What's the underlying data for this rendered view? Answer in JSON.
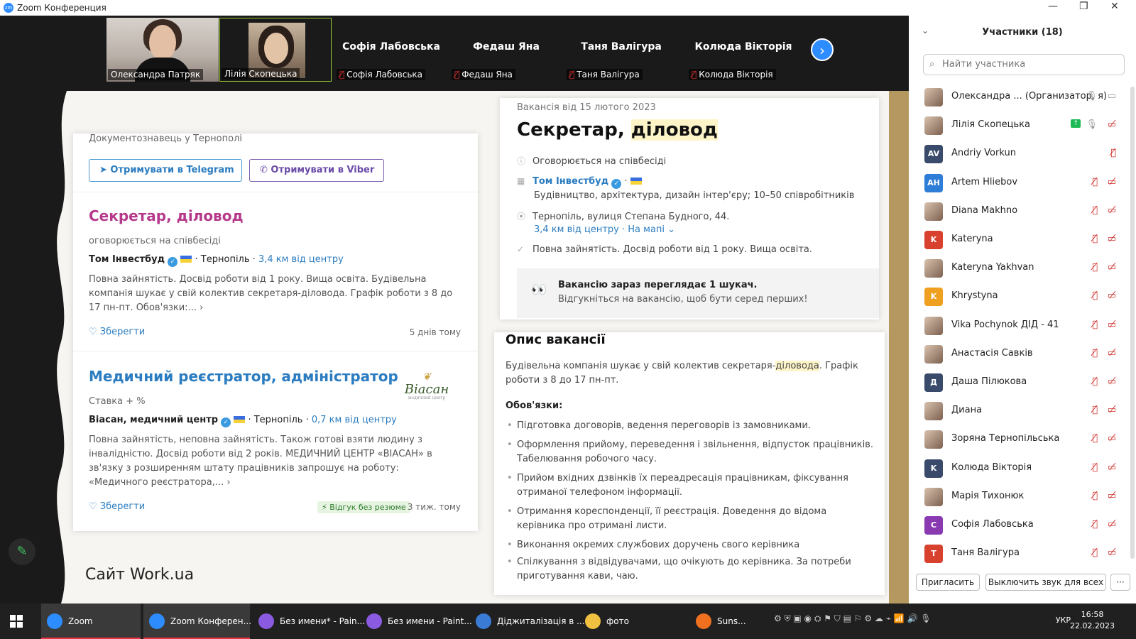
{
  "window": {
    "title": "Zoom Конференция"
  },
  "strip": {
    "tiles": [
      {
        "name": "Олександра Патряк"
      },
      {
        "name": "Лілія Скопецька"
      },
      {
        "name": "Софія Лабовська",
        "label": "Софія Лабовська"
      },
      {
        "name": "Федаш Яна",
        "label": "Федаш Яна"
      },
      {
        "name": "Таня Валігура",
        "label": "Таня Валігура"
      },
      {
        "name": "Колюда Вікторія",
        "label": "Колюда Вікторія"
      }
    ]
  },
  "left": {
    "header": "Документознавець у Тернополі",
    "telegram": "Отримувати в Telegram",
    "viber": "Отримувати в Viber",
    "jobs": [
      {
        "title": "Секретар, діловод",
        "salary": "оговорюється на співбесіді",
        "company": "Том Інвестбуд",
        "city": "· Тернопіль ·",
        "distance": "3,4 км від центру",
        "desc": "Повна зайнятість. Досвід роботи від 1 року. Вища освіта. Будівельна компанія шукає у свій колектив секретаря-діловода. Графік роботи з 8 до 17 пн-пт. Обов'язки:... ›",
        "save": "Зберегти",
        "ago": "5 днів тому"
      },
      {
        "title": "Медичний реєстратор, адміністратор",
        "salary": "Ставка + %",
        "company": "Віасан, медичний центр",
        "city": "· Тернопіль ·",
        "distance": "0,7 км від центру",
        "desc": "Повна зайнятість, неповна зайнятість. Також готові взяти людину з інвалідністю. Досвід роботи від 2 років. МЕДИЧНИЙ ЦЕНТР «ВІАСАН» в зв'язку з розширенням штату працівників запрошує на роботу: «Медичного реєстратора,... ›",
        "save": "Зберегти",
        "badge": "⚡ Відгук без резюме",
        "ago": "3 тиж. тому",
        "logo": "Віасан",
        "logo_sub": "медичний центр"
      }
    ],
    "site_label": "Сайт Work.ua"
  },
  "right": {
    "posted": "Вакансія від 15 лютого 2023",
    "title_a": "Секретар, ",
    "title_b": "діловод",
    "salary": "Оговорюється на співбесіді",
    "company": "Том Інвестбуд",
    "company_info": "Будівництво, архітектура, дизайн інтер'єру; 10–50 співробітників",
    "address": "Тернопіль, вулиця Степана Будного, 44.",
    "distance": "3,4 км від центру",
    "map": "· На мапі ⌄",
    "terms": "Повна зайнятість. Досвід роботи від 1 року. Вища освіта.",
    "notice_a": "Вакансію зараз переглядає 1 шукач.",
    "notice_b": "Відгукніться на вакансію, щоб бути серед перших!",
    "desc_title": "Опис вакансії",
    "desc_a": "Будівельна компанія шукає у свій колектив секретаря-",
    "desc_hl": "діловода",
    "desc_b": ". Графік роботи з 8 до 17 пн-пт.",
    "duties_title": "Обов'язки:",
    "duties": [
      "Підготовка договорів, ведення переговорів із замовниками.",
      "Оформлення прийому, переведення і звільнення, відпусток працівників. Табелювання робочого часу.",
      "Прийом вхідних дзвінків їх переадресація працівникам, фіксування отриманої телефоном інформації.",
      "Отримання кореспонденції, її реєстрація. Доведення до відома керівника про отримані листи.",
      "Виконання окремих службових доручень свого керівника",
      "Спілкування з відвідувачами, що очікують до керівника. За потреби приготування кави, чаю."
    ]
  },
  "participants": {
    "title": "Участники (18)",
    "search_placeholder": "Найти участника",
    "list": [
      {
        "name": "Олександра ... (Организатор, я)",
        "initials": "",
        "color": ""
      },
      {
        "name": "Лілія Скопецька",
        "initials": "",
        "color": ""
      },
      {
        "name": "Andriy Vorkun",
        "initials": "AV",
        "color": "#3a4a6a"
      },
      {
        "name": "Artem Hliebov",
        "initials": "AH",
        "color": "#2e7dd6"
      },
      {
        "name": "Diana Makhno",
        "initials": "",
        "color": ""
      },
      {
        "name": "Kateryna",
        "initials": "K",
        "color": "#d9412f"
      },
      {
        "name": "Kateryna Yakhvan",
        "initials": "",
        "color": ""
      },
      {
        "name": "Khrystyna",
        "initials": "K",
        "color": "#f0a020"
      },
      {
        "name": "Vika Pochynok ДІД - 41",
        "initials": "",
        "color": ""
      },
      {
        "name": "Анастасія Савків",
        "initials": "",
        "color": ""
      },
      {
        "name": "Даша Пілюкова",
        "initials": "Д",
        "color": "#3a4a6a"
      },
      {
        "name": "Диана",
        "initials": "",
        "color": ""
      },
      {
        "name": "Зоряна Тернопільська",
        "initials": "",
        "color": ""
      },
      {
        "name": "Колюда Вікторія",
        "initials": "K",
        "color": "#3a4a6a"
      },
      {
        "name": "Марія Тихонюк",
        "initials": "",
        "color": ""
      },
      {
        "name": "Софія Лабовська",
        "initials": "C",
        "color": "#8a3ab0"
      },
      {
        "name": "Таня Валігура",
        "initials": "T",
        "color": "#d9412f"
      }
    ],
    "invite": "Пригласить",
    "mute_all": "Выключить звук для всех",
    "more": "···"
  },
  "taskbar": {
    "items": [
      {
        "label": "Zoom",
        "color": "#2d8cff"
      },
      {
        "label": "Zoom Конферен...",
        "color": "#2d8cff"
      },
      {
        "label": "Без имени* - Pain...",
        "color": "#8a5ae0"
      },
      {
        "label": "Без имени - Paint...",
        "color": "#8a5ae0"
      },
      {
        "label": "Діджиталізація в ...",
        "color": "#3a7bd5"
      },
      {
        "label": "фото",
        "color": "#f0c040"
      },
      {
        "label": "Suns...",
        "color": "#f07020"
      }
    ],
    "lang": "УКР",
    "time": "16:58",
    "date": "22.02.2023"
  }
}
